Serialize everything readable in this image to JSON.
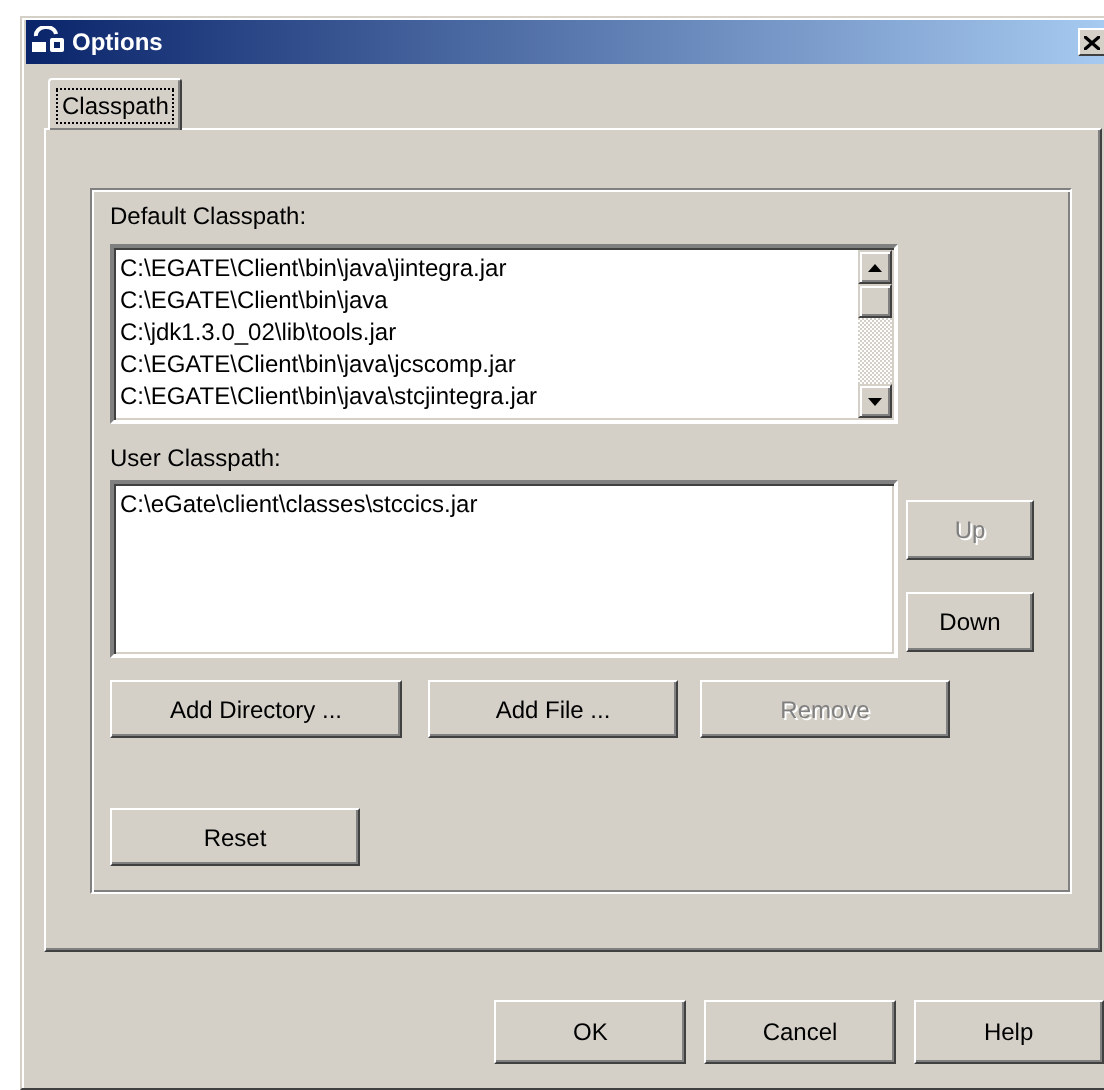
{
  "window": {
    "title": "Options"
  },
  "tabs": [
    {
      "label": "Classpath",
      "selected": true
    }
  ],
  "default_classpath": {
    "label": "Default Classpath:",
    "items": [
      "C:\\EGATE\\Client\\bin\\java\\jintegra.jar",
      "C:\\EGATE\\Client\\bin\\java",
      "C:\\jdk1.3.0_02\\lib\\tools.jar",
      "C:\\EGATE\\Client\\bin\\java\\jcscomp.jar",
      "C:\\EGATE\\Client\\bin\\java\\stcjintegra.jar"
    ]
  },
  "user_classpath": {
    "label": "User Classpath:",
    "items": [
      "C:\\eGate\\client\\classes\\stccics.jar"
    ]
  },
  "side_buttons": [
    {
      "label": "Up",
      "disabled": true
    },
    {
      "label": "Down",
      "disabled": false
    }
  ],
  "action_buttons": [
    {
      "label": "Add Directory ...",
      "disabled": false
    },
    {
      "label": "Add File ...",
      "disabled": false
    },
    {
      "label": "Remove",
      "disabled": true
    }
  ],
  "reset_button": {
    "label": "Reset",
    "disabled": false
  },
  "dialog_buttons": [
    {
      "label": "OK",
      "disabled": false
    },
    {
      "label": "Cancel",
      "disabled": false
    },
    {
      "label": "Help",
      "disabled": false
    }
  ]
}
